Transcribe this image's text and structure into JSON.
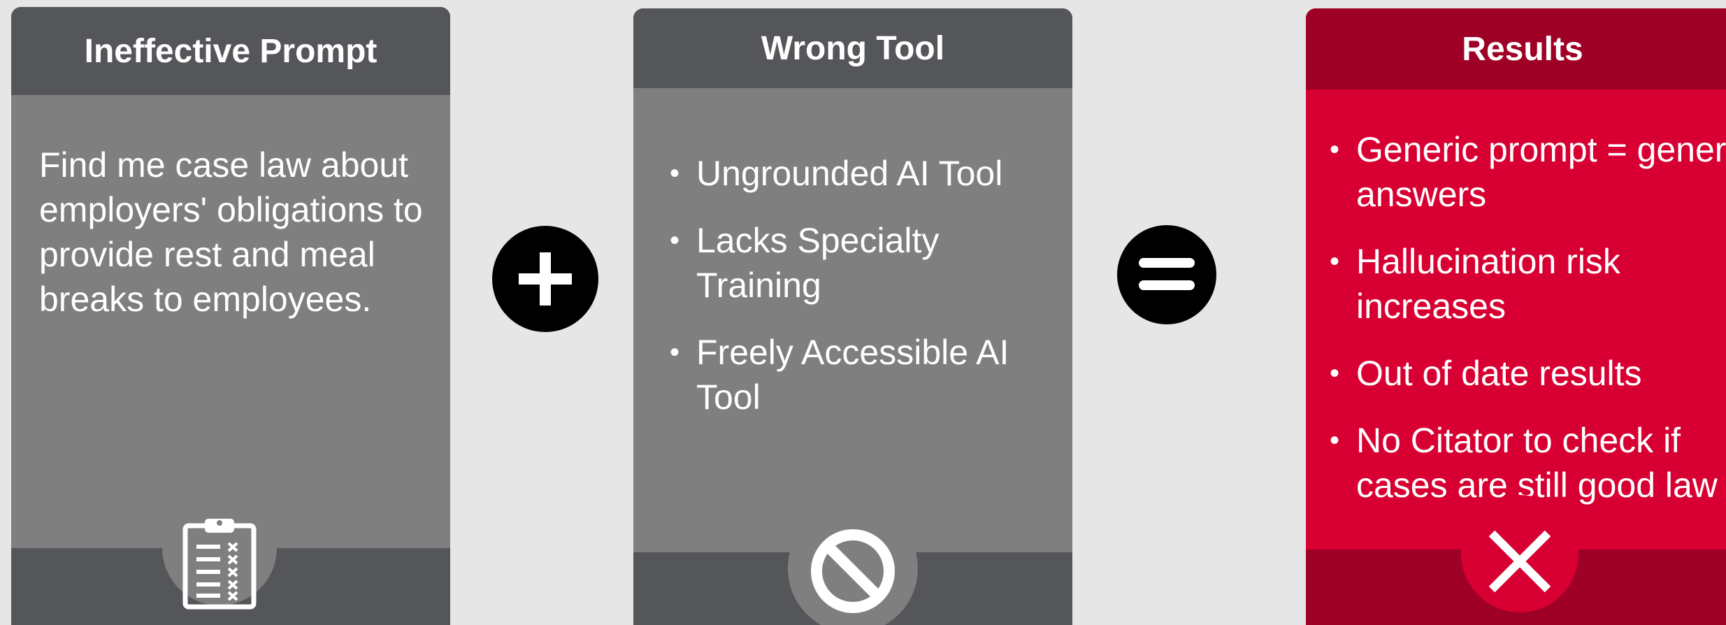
{
  "cards": [
    {
      "title": "Ineffective Prompt",
      "text": "Find me case law about employers' obligations to provide rest and meal breaks to employees.",
      "icon": "clipboard-checklist-icon"
    },
    {
      "title": "Wrong Tool",
      "bullets": [
        "Ungrounded AI Tool",
        "Lacks Specialty Training",
        "Freely Accessible AI Tool"
      ],
      "icon": "prohibited-icon"
    },
    {
      "title": "Results",
      "bullets": [
        "Generic prompt = generic answers",
        "Hallucination risk increases",
        "Out of date results",
        "No Citator to check if cases are still good law"
      ],
      "icon": "x-mark-icon"
    }
  ],
  "operators": [
    "plus-icon",
    "equals-icon"
  ],
  "colors": {
    "background": "#e6e6e6",
    "gray_header": "#55565a",
    "gray_body": "#7f7f7f",
    "red_header": "#9e0026",
    "red_body": "#d80032",
    "operator": "#000000"
  }
}
